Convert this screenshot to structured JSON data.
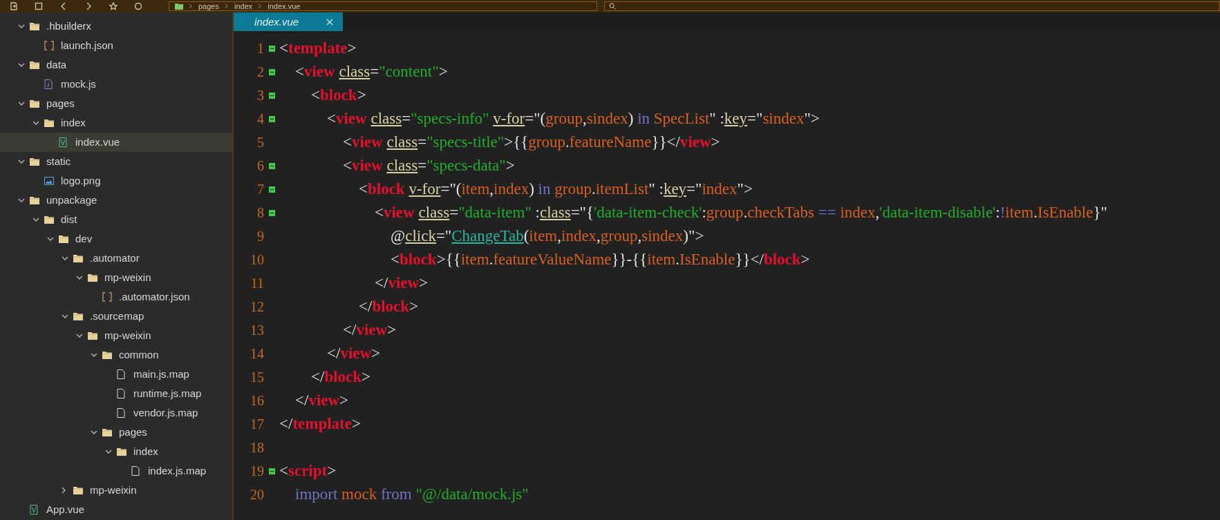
{
  "toolbar": {
    "breadcrumb": [
      "pages",
      "index",
      "index.vue"
    ]
  },
  "sidebar": {
    "tree": [
      {
        "name": ".hbuilderx",
        "kind": "folder",
        "expanded": true,
        "selected": false,
        "children": [
          {
            "name": "launch.json",
            "kind": "json",
            "selected": false
          }
        ]
      },
      {
        "name": "data",
        "kind": "folder",
        "expanded": true,
        "selected": false,
        "children": [
          {
            "name": "mock.js",
            "kind": "js",
            "selected": false
          }
        ]
      },
      {
        "name": "pages",
        "kind": "folder",
        "expanded": true,
        "selected": false,
        "children": [
          {
            "name": "index",
            "kind": "folder",
            "expanded": true,
            "selected": false,
            "children": [
              {
                "name": "index.vue",
                "kind": "vue",
                "selected": true
              }
            ]
          }
        ]
      },
      {
        "name": "static",
        "kind": "folder",
        "expanded": true,
        "selected": false,
        "children": [
          {
            "name": "logo.png",
            "kind": "image",
            "selected": false
          }
        ]
      },
      {
        "name": "unpackage",
        "kind": "folder",
        "expanded": true,
        "selected": false,
        "children": [
          {
            "name": "dist",
            "kind": "folder",
            "expanded": true,
            "selected": false,
            "children": [
              {
                "name": "dev",
                "kind": "folder",
                "expanded": true,
                "selected": false,
                "children": [
                  {
                    "name": ".automator",
                    "kind": "folder",
                    "expanded": true,
                    "selected": false,
                    "children": [
                      {
                        "name": "mp-weixin",
                        "kind": "folder",
                        "expanded": true,
                        "selected": false,
                        "children": [
                          {
                            "name": ".automator.json",
                            "kind": "json",
                            "selected": false
                          }
                        ]
                      }
                    ]
                  },
                  {
                    "name": ".sourcemap",
                    "kind": "folder",
                    "expanded": true,
                    "selected": false,
                    "children": [
                      {
                        "name": "mp-weixin",
                        "kind": "folder",
                        "expanded": true,
                        "selected": false,
                        "children": [
                          {
                            "name": "common",
                            "kind": "folder",
                            "expanded": true,
                            "selected": false,
                            "children": [
                              {
                                "name": "main.js.map",
                                "kind": "map",
                                "selected": false
                              },
                              {
                                "name": "runtime.js.map",
                                "kind": "map",
                                "selected": false
                              },
                              {
                                "name": "vendor.js.map",
                                "kind": "map",
                                "selected": false
                              }
                            ]
                          },
                          {
                            "name": "pages",
                            "kind": "folder",
                            "expanded": true,
                            "selected": false,
                            "children": [
                              {
                                "name": "index",
                                "kind": "folder",
                                "expanded": true,
                                "selected": false,
                                "children": [
                                  {
                                    "name": "index.js.map",
                                    "kind": "map",
                                    "selected": false
                                  }
                                ]
                              }
                            ]
                          }
                        ]
                      }
                    ]
                  },
                  {
                    "name": "mp-weixin",
                    "kind": "folder",
                    "expanded": false,
                    "selected": false
                  }
                ]
              }
            ]
          }
        ]
      },
      {
        "name": "App.vue",
        "kind": "vue",
        "selected": false
      }
    ]
  },
  "tabs": [
    {
      "label": "index.vue",
      "selected": true
    }
  ],
  "editor": {
    "lines": [
      {
        "number": "1",
        "foldable": true,
        "tokens": [
          {
            "kind": "p",
            "text": "<"
          },
          {
            "kind": "tag",
            "text": "template"
          },
          {
            "kind": "p",
            "text": ">"
          }
        ]
      },
      {
        "number": "2",
        "foldable": true,
        "tokens": [
          {
            "kind": "p",
            "text": "    <"
          },
          {
            "kind": "tag",
            "text": "view "
          },
          {
            "kind": "attr",
            "text": "class"
          },
          {
            "kind": "p",
            "text": "="
          },
          {
            "kind": "str",
            "text": "\"content\""
          },
          {
            "kind": "p",
            "text": ">"
          }
        ]
      },
      {
        "number": "3",
        "foldable": true,
        "tokens": [
          {
            "kind": "p",
            "text": "        <"
          },
          {
            "kind": "tag",
            "text": "block"
          },
          {
            "kind": "p",
            "text": ">"
          }
        ]
      },
      {
        "number": "4",
        "foldable": true,
        "tokens": [
          {
            "kind": "p",
            "text": "            <"
          },
          {
            "kind": "tag",
            "text": "view "
          },
          {
            "kind": "attr",
            "text": "class"
          },
          {
            "kind": "p",
            "text": "="
          },
          {
            "kind": "str",
            "text": "\"specs-info\" "
          },
          {
            "kind": "attr",
            "text": "v-for"
          },
          {
            "kind": "p",
            "text": "=\"("
          },
          {
            "kind": "var",
            "text": "group"
          },
          {
            "kind": "p",
            "text": ","
          },
          {
            "kind": "var",
            "text": "sindex"
          },
          {
            "kind": "p",
            "text": ")"
          },
          {
            "kind": "kw",
            "text": " in "
          },
          {
            "kind": "var",
            "text": "SpecList"
          },
          {
            "kind": "p",
            "text": "\" :"
          },
          {
            "kind": "attr",
            "text": "key"
          },
          {
            "kind": "p",
            "text": "=\""
          },
          {
            "kind": "var",
            "text": "sindex"
          },
          {
            "kind": "p",
            "text": "\">"
          }
        ]
      },
      {
        "number": "5",
        "foldable": false,
        "tokens": [
          {
            "kind": "p",
            "text": "                <"
          },
          {
            "kind": "tag",
            "text": "view "
          },
          {
            "kind": "attr",
            "text": "class"
          },
          {
            "kind": "p",
            "text": "="
          },
          {
            "kind": "str",
            "text": "\"specs-title\""
          },
          {
            "kind": "p",
            "text": ">{{"
          },
          {
            "kind": "var",
            "text": "group"
          },
          {
            "kind": "p",
            "text": "."
          },
          {
            "kind": "var",
            "text": "featureName"
          },
          {
            "kind": "p",
            "text": "}}</"
          },
          {
            "kind": "tag",
            "text": "view"
          },
          {
            "kind": "p",
            "text": ">"
          }
        ]
      },
      {
        "number": "6",
        "foldable": true,
        "tokens": [
          {
            "kind": "p",
            "text": "                <"
          },
          {
            "kind": "tag",
            "text": "view "
          },
          {
            "kind": "attr",
            "text": "class"
          },
          {
            "kind": "p",
            "text": "="
          },
          {
            "kind": "str",
            "text": "\"specs-data\""
          },
          {
            "kind": "p",
            "text": ">"
          }
        ]
      },
      {
        "number": "7",
        "foldable": true,
        "tokens": [
          {
            "kind": "p",
            "text": "                    <"
          },
          {
            "kind": "tag",
            "text": "block "
          },
          {
            "kind": "attr",
            "text": "v-for"
          },
          {
            "kind": "p",
            "text": "=\"("
          },
          {
            "kind": "var",
            "text": "item"
          },
          {
            "kind": "p",
            "text": ","
          },
          {
            "kind": "var",
            "text": "index"
          },
          {
            "kind": "p",
            "text": ")"
          },
          {
            "kind": "kw",
            "text": " in "
          },
          {
            "kind": "var",
            "text": "group"
          },
          {
            "kind": "p",
            "text": "."
          },
          {
            "kind": "var",
            "text": "itemList"
          },
          {
            "kind": "p",
            "text": "\" :"
          },
          {
            "kind": "attr",
            "text": "key"
          },
          {
            "kind": "p",
            "text": "=\""
          },
          {
            "kind": "var",
            "text": "index"
          },
          {
            "kind": "p",
            "text": "\">"
          }
        ]
      },
      {
        "number": "8",
        "foldable": true,
        "tokens": [
          {
            "kind": "p",
            "text": "                        <"
          },
          {
            "kind": "tag",
            "text": "view "
          },
          {
            "kind": "attr",
            "text": "class"
          },
          {
            "kind": "p",
            "text": "="
          },
          {
            "kind": "str",
            "text": "\"data-item\""
          },
          {
            "kind": "p",
            "text": " :"
          },
          {
            "kind": "attr",
            "text": "class"
          },
          {
            "kind": "p",
            "text": "=\"{"
          },
          {
            "kind": "str",
            "text": "'data-item-check'"
          },
          {
            "kind": "p",
            "text": ":"
          },
          {
            "kind": "var",
            "text": "group"
          },
          {
            "kind": "p",
            "text": "."
          },
          {
            "kind": "var",
            "text": "checkTabs"
          },
          {
            "kind": "op",
            "text": " == "
          },
          {
            "kind": "var",
            "text": "index"
          },
          {
            "kind": "p",
            "text": ","
          },
          {
            "kind": "str",
            "text": "'data-item-disable'"
          },
          {
            "kind": "p",
            "text": ":"
          },
          {
            "kind": "op",
            "text": "!"
          },
          {
            "kind": "var",
            "text": "item"
          },
          {
            "kind": "p",
            "text": "."
          },
          {
            "kind": "var",
            "text": "IsEnable"
          },
          {
            "kind": "p",
            "text": "}\""
          }
        ]
      },
      {
        "number": "9",
        "foldable": false,
        "tokens": [
          {
            "kind": "p",
            "text": "                            @"
          },
          {
            "kind": "attr",
            "text": "click"
          },
          {
            "kind": "p",
            "text": "=\""
          },
          {
            "kind": "fn",
            "text": "ChangeTab"
          },
          {
            "kind": "p",
            "text": "("
          },
          {
            "kind": "var",
            "text": "item"
          },
          {
            "kind": "p",
            "text": ","
          },
          {
            "kind": "var",
            "text": "index"
          },
          {
            "kind": "p",
            "text": ","
          },
          {
            "kind": "var",
            "text": "group"
          },
          {
            "kind": "p",
            "text": ","
          },
          {
            "kind": "var",
            "text": "sindex"
          },
          {
            "kind": "p",
            "text": ")\">"
          }
        ]
      },
      {
        "number": "10",
        "foldable": false,
        "tokens": [
          {
            "kind": "p",
            "text": "                            <"
          },
          {
            "kind": "tag",
            "text": "block"
          },
          {
            "kind": "p",
            "text": ">{{"
          },
          {
            "kind": "var",
            "text": "item"
          },
          {
            "kind": "p",
            "text": "."
          },
          {
            "kind": "var",
            "text": "featureValueName"
          },
          {
            "kind": "p",
            "text": "}}-{{"
          },
          {
            "kind": "var",
            "text": "item"
          },
          {
            "kind": "p",
            "text": "."
          },
          {
            "kind": "var",
            "text": "IsEnable"
          },
          {
            "kind": "p",
            "text": "}}</"
          },
          {
            "kind": "tag",
            "text": "block"
          },
          {
            "kind": "p",
            "text": ">"
          }
        ]
      },
      {
        "number": "11",
        "foldable": false,
        "tokens": [
          {
            "kind": "p",
            "text": "                        </"
          },
          {
            "kind": "tag",
            "text": "view"
          },
          {
            "kind": "p",
            "text": ">"
          }
        ]
      },
      {
        "number": "12",
        "foldable": false,
        "tokens": [
          {
            "kind": "p",
            "text": "                    </"
          },
          {
            "kind": "tag",
            "text": "block"
          },
          {
            "kind": "p",
            "text": ">"
          }
        ]
      },
      {
        "number": "13",
        "foldable": false,
        "tokens": [
          {
            "kind": "p",
            "text": "                </"
          },
          {
            "kind": "tag",
            "text": "view"
          },
          {
            "kind": "p",
            "text": ">"
          }
        ]
      },
      {
        "number": "14",
        "foldable": false,
        "tokens": [
          {
            "kind": "p",
            "text": "            </"
          },
          {
            "kind": "tag",
            "text": "view"
          },
          {
            "kind": "p",
            "text": ">"
          }
        ]
      },
      {
        "number": "15",
        "foldable": false,
        "tokens": [
          {
            "kind": "p",
            "text": "        </"
          },
          {
            "kind": "tag",
            "text": "block"
          },
          {
            "kind": "p",
            "text": ">"
          }
        ]
      },
      {
        "number": "16",
        "foldable": false,
        "tokens": [
          {
            "kind": "p",
            "text": "    </"
          },
          {
            "kind": "tag",
            "text": "view"
          },
          {
            "kind": "p",
            "text": ">"
          }
        ]
      },
      {
        "number": "17",
        "foldable": false,
        "tokens": [
          {
            "kind": "p",
            "text": "</"
          },
          {
            "kind": "tag",
            "text": "template"
          },
          {
            "kind": "p",
            "text": ">"
          }
        ]
      },
      {
        "number": "18",
        "foldable": false
      },
      {
        "number": "19",
        "foldable": true,
        "tokens": [
          {
            "kind": "p",
            "text": "<"
          },
          {
            "kind": "tag",
            "text": "script"
          },
          {
            "kind": "p",
            "text": ">"
          }
        ]
      },
      {
        "number": "20",
        "foldable": false,
        "tokens": [
          {
            "kind": "kw",
            "text": "    import "
          },
          {
            "kind": "var",
            "text": "mock "
          },
          {
            "kind": "kw",
            "text": "from "
          },
          {
            "kind": "str",
            "text": "\"@/data/mock.js\""
          }
        ]
      }
    ]
  }
}
